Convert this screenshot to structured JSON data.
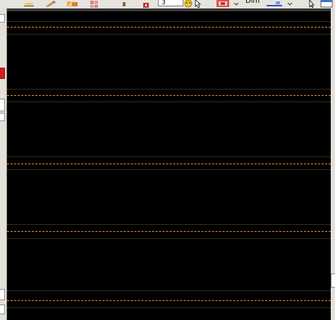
{
  "toolbar": {
    "spin_value": "3",
    "dim_label": "Dim",
    "icons": [
      "underline-icon",
      "pencil-icon",
      "components-icon",
      "grid-icon",
      "lock-icon",
      "smiley-icon",
      "pointer-icon",
      "image-icon",
      "dimension-icon",
      "cursor-icon",
      "window-icon"
    ]
  },
  "canvas": {
    "background": "#000000",
    "guide_color": "#ff8c1a",
    "dot_color": "#8a6d3a",
    "staff_count": 5
  }
}
